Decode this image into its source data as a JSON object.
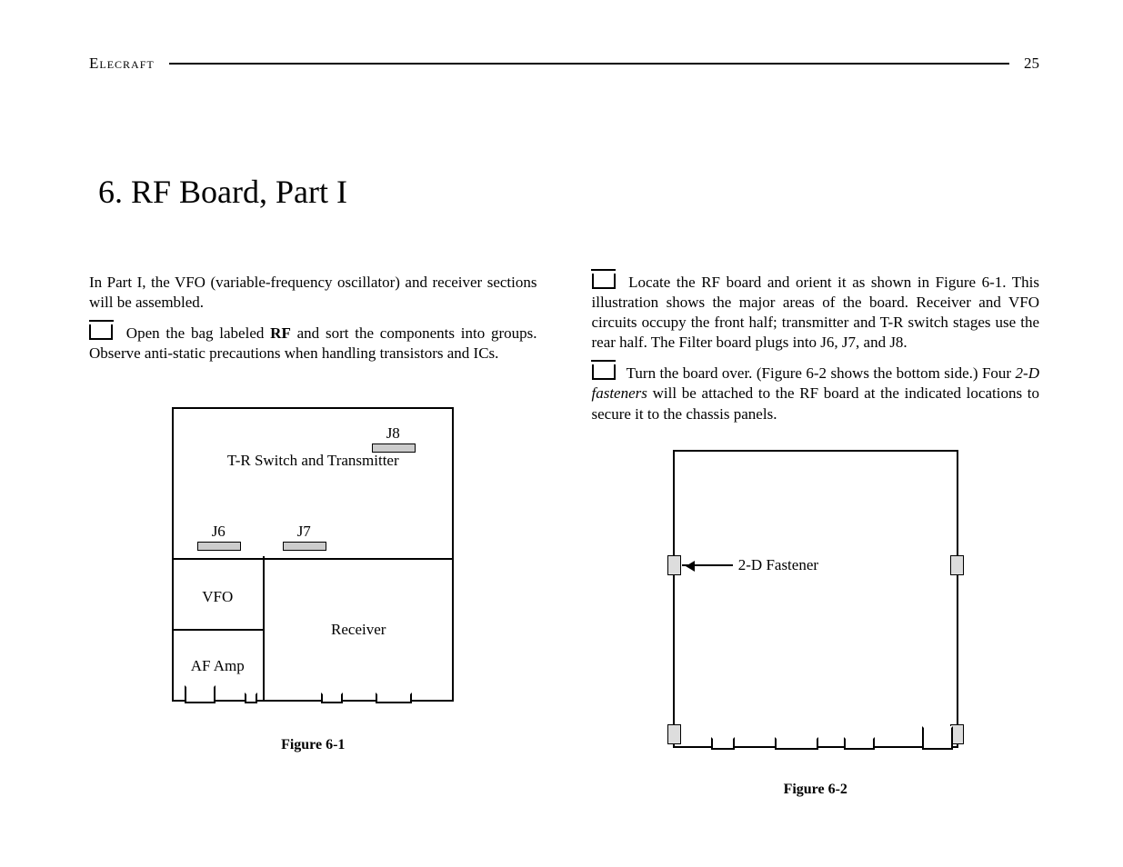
{
  "header": {
    "brand": "Elecraft",
    "page_number": "25"
  },
  "title": "6.  RF Board, Part I",
  "left_column": {
    "intro": "In Part I, the VFO (variable-frequency oscillator) and receiver sections will be assembled.",
    "step1_a": "Open the bag labeled ",
    "step1_bold": "RF",
    "step1_b": " and sort the components into groups. Observe anti-static precautions when handling transistors and ICs."
  },
  "right_column": {
    "step2": "Locate the RF board and orient it as shown in Figure 6-1. This illustration shows the major areas of the board. Receiver and VFO circuits occupy the front half; transmitter and T-R switch stages use the rear half. The Filter board plugs into J6, J7, and J8.",
    "step3_a": "Turn the board over. (Figure 6-2 shows the bottom side.) Four ",
    "step3_italic": "2-D fasteners",
    "step3_b": " will be attached to the RF board at the indicated locations to secure it to the chassis panels."
  },
  "figure1": {
    "caption": "Figure  6-1",
    "labels": {
      "tr": "T-R Switch and Transmitter",
      "vfo": "VFO",
      "af": "AF Amp",
      "rx": "Receiver",
      "j6": "J6",
      "j7": "J7",
      "j8": "J8"
    }
  },
  "figure2": {
    "caption": "Figure  6-2",
    "fastener_label": "2-D Fastener"
  }
}
